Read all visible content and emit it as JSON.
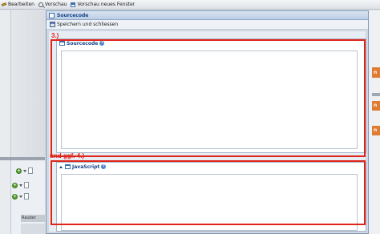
{
  "toolbar": {
    "edit_label": "Bearbeiten",
    "preview_label": "Vorschau",
    "preview_new_window_label": "Vorschau neues Fenster"
  },
  "background": {
    "row_label": "Rauber",
    "right_tabs": [
      "n",
      "n",
      "n"
    ]
  },
  "dialog": {
    "title": "Sourcecode",
    "save_close_label": "Speichern und schliessen"
  },
  "panels": {
    "sourcecode": {
      "title": "Sourcecode",
      "help": "?"
    },
    "javascript": {
      "title": "JavaScript",
      "help": "?"
    }
  },
  "annotations": {
    "step3": "3.)",
    "step4": "und ggf. 4.)"
  },
  "colors": {
    "annotation": "#e0241b",
    "header_text": "#15428b",
    "accent_orange": "#e07b32"
  }
}
